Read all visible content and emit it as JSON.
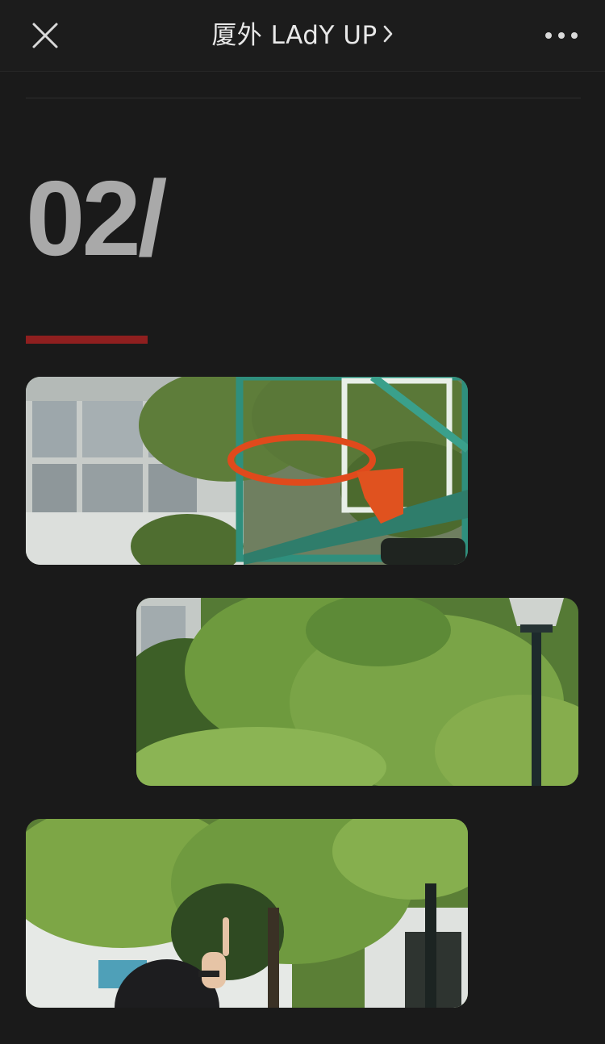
{
  "navbar": {
    "title": "厦外 LAdY UP"
  },
  "article": {
    "section_number": "02/",
    "accent_color": "#8f1f1f"
  },
  "photos": [
    {
      "subject": "basketball-hoop"
    },
    {
      "subject": "trees-with-lamp-post"
    },
    {
      "subject": "trees-with-person-pointing"
    }
  ]
}
